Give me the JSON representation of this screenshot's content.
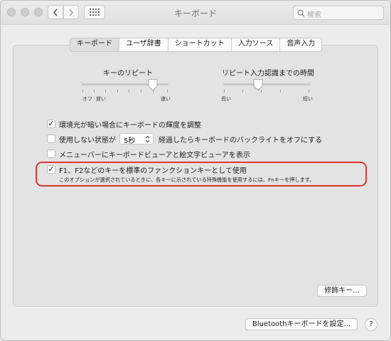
{
  "window": {
    "title": "キーボード"
  },
  "search": {
    "placeholder": "検索"
  },
  "tabs": [
    {
      "label": "キーボード",
      "selected": true
    },
    {
      "label": "ユーザ辞書",
      "selected": false
    },
    {
      "label": "ショートカット",
      "selected": false
    },
    {
      "label": "入力ソース",
      "selected": false
    },
    {
      "label": "音声入力",
      "selected": false
    }
  ],
  "key_repeat": {
    "label": "キーのリピート",
    "min_label": "オフ",
    "slow_label": "遅い",
    "max_label": "速い"
  },
  "repeat_delay": {
    "label": "リピート入力認識までの時間",
    "min_label": "長い",
    "max_label": "短い"
  },
  "options": {
    "brightness": {
      "label": "環境光が暗い場合にキーボードの輝度を調整",
      "checked": true
    },
    "backlight": {
      "label_before": "使用しない状態が",
      "value": "5秒",
      "label_after": "経過したらキーボードのバックライトをオフにする",
      "checked": false
    },
    "viewer": {
      "label": "メニューバーにキーボードビューアと絵文字ビューアを表示",
      "checked": false
    },
    "fn_keys": {
      "label": "F1、F2などのキーを標準のファンクションキーとして使用",
      "description": "このオプションが選択されているときに、各キーに示されている特殊機能を使用するには、Fnキーを押します。",
      "checked": true
    }
  },
  "buttons": {
    "modifier_keys": "修飾キー...",
    "bluetooth": "Bluetoothキーボードを設定...",
    "help": "?"
  },
  "colors": {
    "highlight": "#e0382e"
  }
}
